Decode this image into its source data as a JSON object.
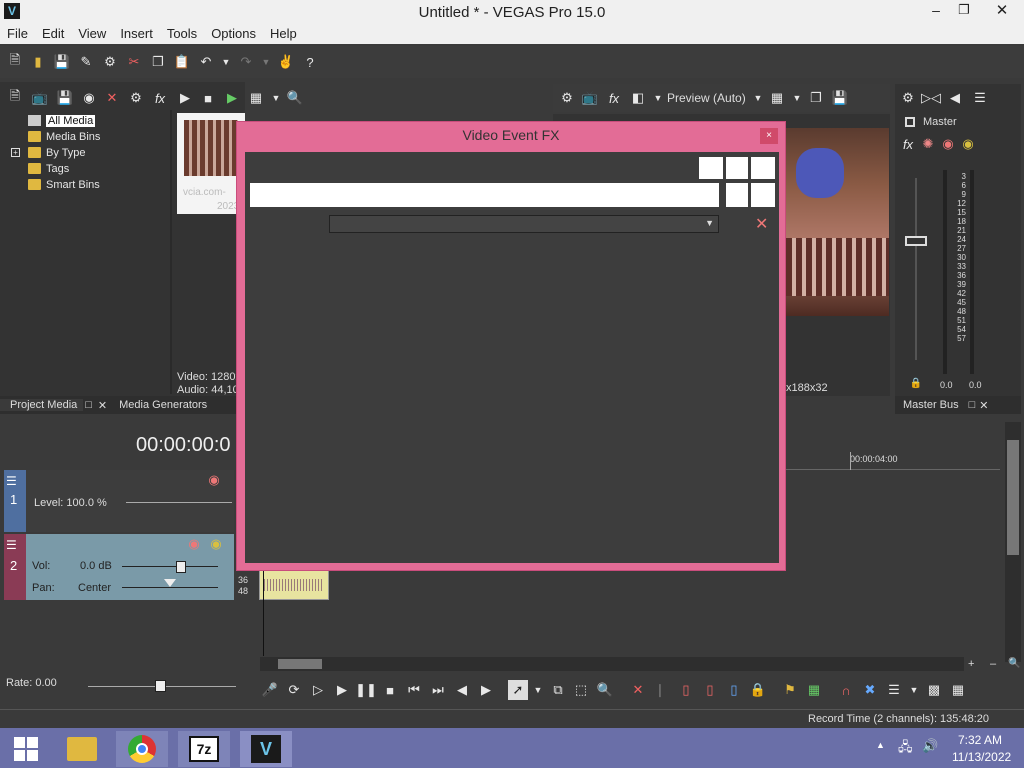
{
  "window": {
    "title": "Untitled * - VEGAS Pro 15.0",
    "logo": "V"
  },
  "menu": [
    "File",
    "Edit",
    "View",
    "Insert",
    "Tools",
    "Options",
    "Help"
  ],
  "explorer": {
    "items": [
      "All Media",
      "Media Bins",
      "By Type",
      "Tags",
      "Smart Bins"
    ],
    "thumb_caption_1": "vcia.com-",
    "thumb_caption_2": "2023",
    "video_info": "Video: 1280x",
    "audio_info": "Audio: 44,10"
  },
  "tabs_left": {
    "project_media": "Project Media",
    "media_generators": "Media Generators"
  },
  "preview": {
    "mode": "Preview (Auto)",
    "frame_info": "x188x32"
  },
  "master": {
    "label": "Master",
    "scale": [
      "3",
      "6",
      "9",
      "12",
      "15",
      "18",
      "21",
      "24",
      "27",
      "30",
      "33",
      "36",
      "39",
      "42",
      "45",
      "48",
      "51",
      "54",
      "57"
    ],
    "left_val": "0.0",
    "right_val": "0.0",
    "tab": "Master Bus"
  },
  "timecode": "00:00:00:0",
  "ruler_mark": "00:00:04:00",
  "tracks": {
    "video": {
      "num": "1",
      "level_label": "Level: 100.0 %"
    },
    "audio": {
      "num": "2",
      "vol_label": "Vol:",
      "vol_value": "0.0 dB",
      "pan_label": "Pan:",
      "pan_value": "Center",
      "scale_a": "36",
      "scale_b": "48"
    }
  },
  "rate": "Rate: 0.00",
  "status": "Record Time (2 channels): 135:48:20",
  "dialog": {
    "title": "Video Event FX",
    "close": "×"
  },
  "taskbar": {
    "time": "7:32 AM",
    "date": "11/13/2022",
    "sevenzip": "7z",
    "vegas": "V"
  },
  "icons": {
    "accent": "#e36c96",
    "track_video_color": "#4f6fa0",
    "track_audio_color": "#8a3b55"
  }
}
